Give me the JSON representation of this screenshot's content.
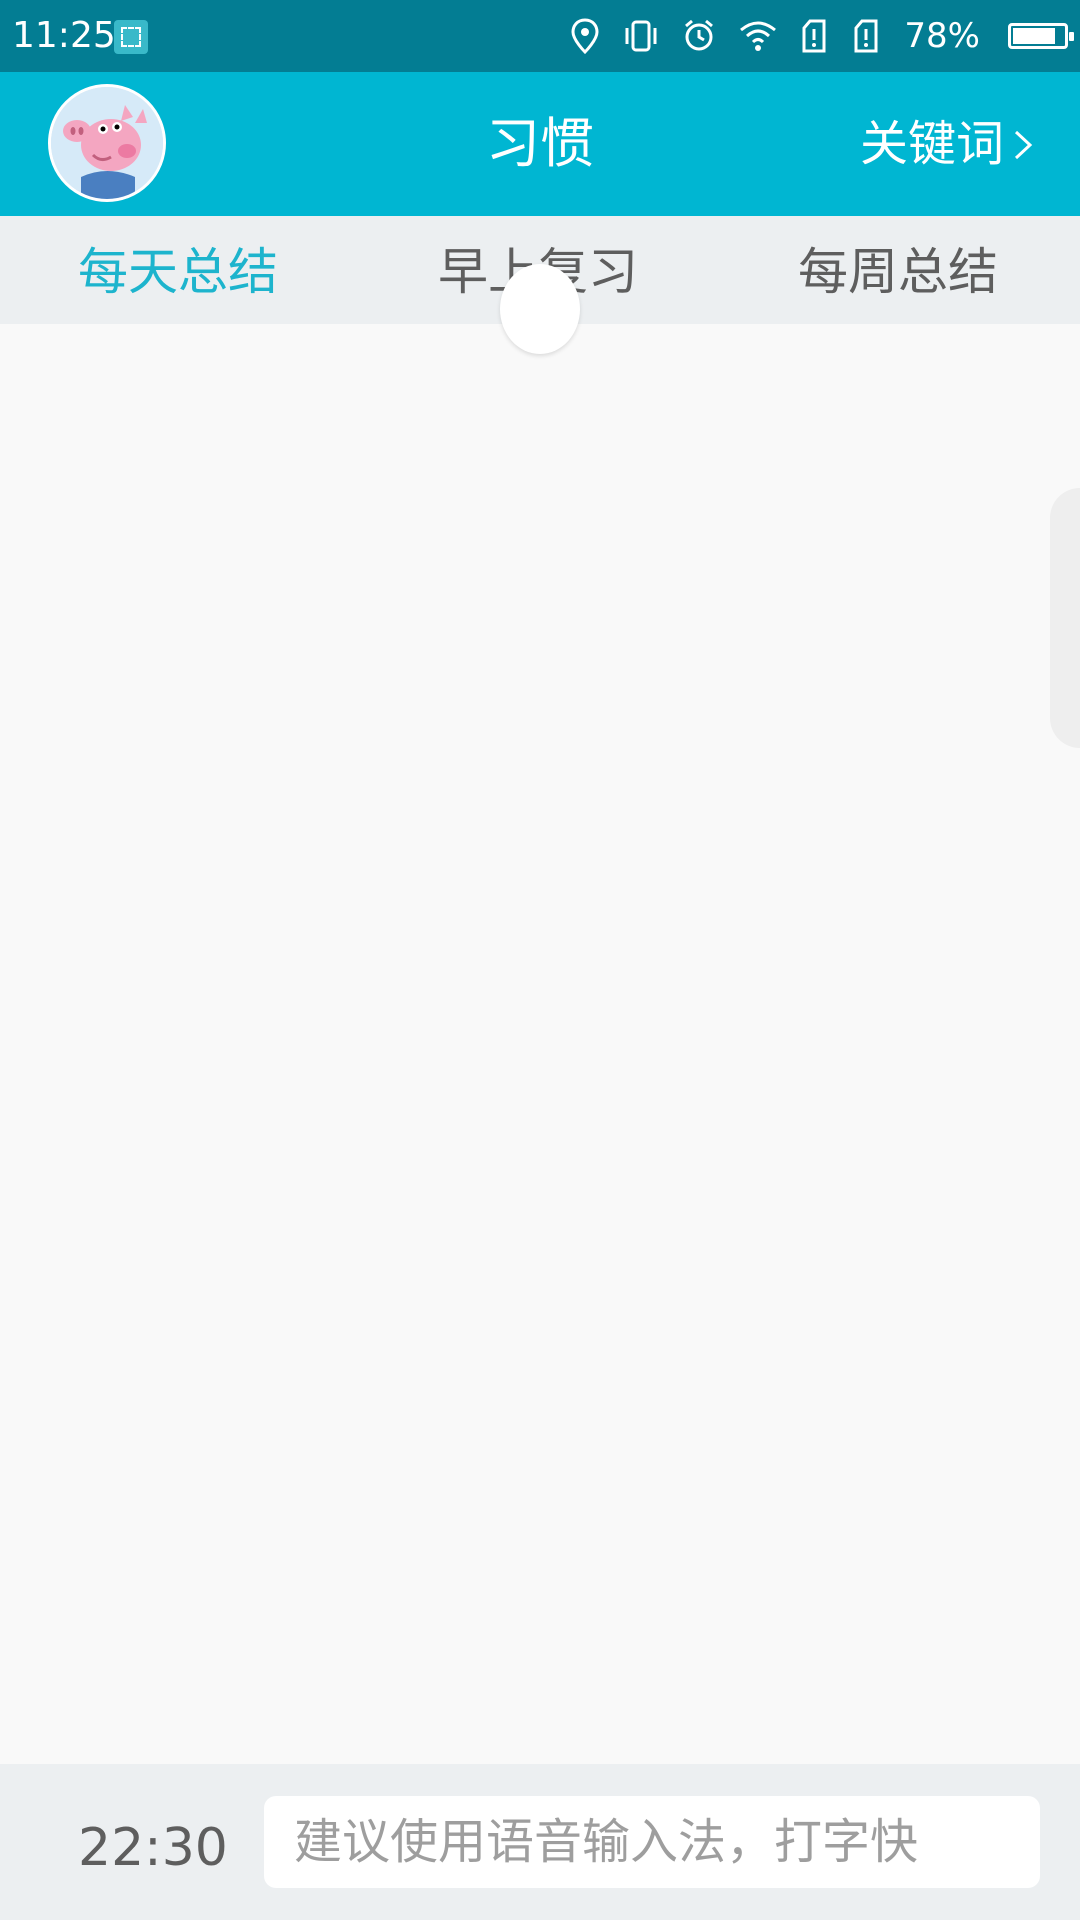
{
  "statusbar": {
    "time": "11:25",
    "battery": "78%",
    "battery_level": 0.78,
    "icons": [
      "screenshot-icon",
      "location-icon",
      "vibrate-icon",
      "alarm-icon",
      "wifi-icon",
      "sim1-icon",
      "sim2-icon",
      "battery-icon"
    ]
  },
  "header": {
    "title": "习惯",
    "keywords_label": "关键词",
    "avatar_icon": "avatar-icon"
  },
  "tabs": [
    {
      "label": "每天总结",
      "active": true
    },
    {
      "label": "早上复习",
      "active": false
    },
    {
      "label": "每周总结",
      "active": false
    }
  ],
  "bottom": {
    "time": "22:30",
    "input_placeholder": "建议使用语音输入法，打字快",
    "input_value": ""
  },
  "colors": {
    "statusbar": "#037d93",
    "header": "#00b6d2",
    "accent": "#1db4cd",
    "tab_bar": "#eceff1",
    "content_bg": "#f9f9f9"
  }
}
